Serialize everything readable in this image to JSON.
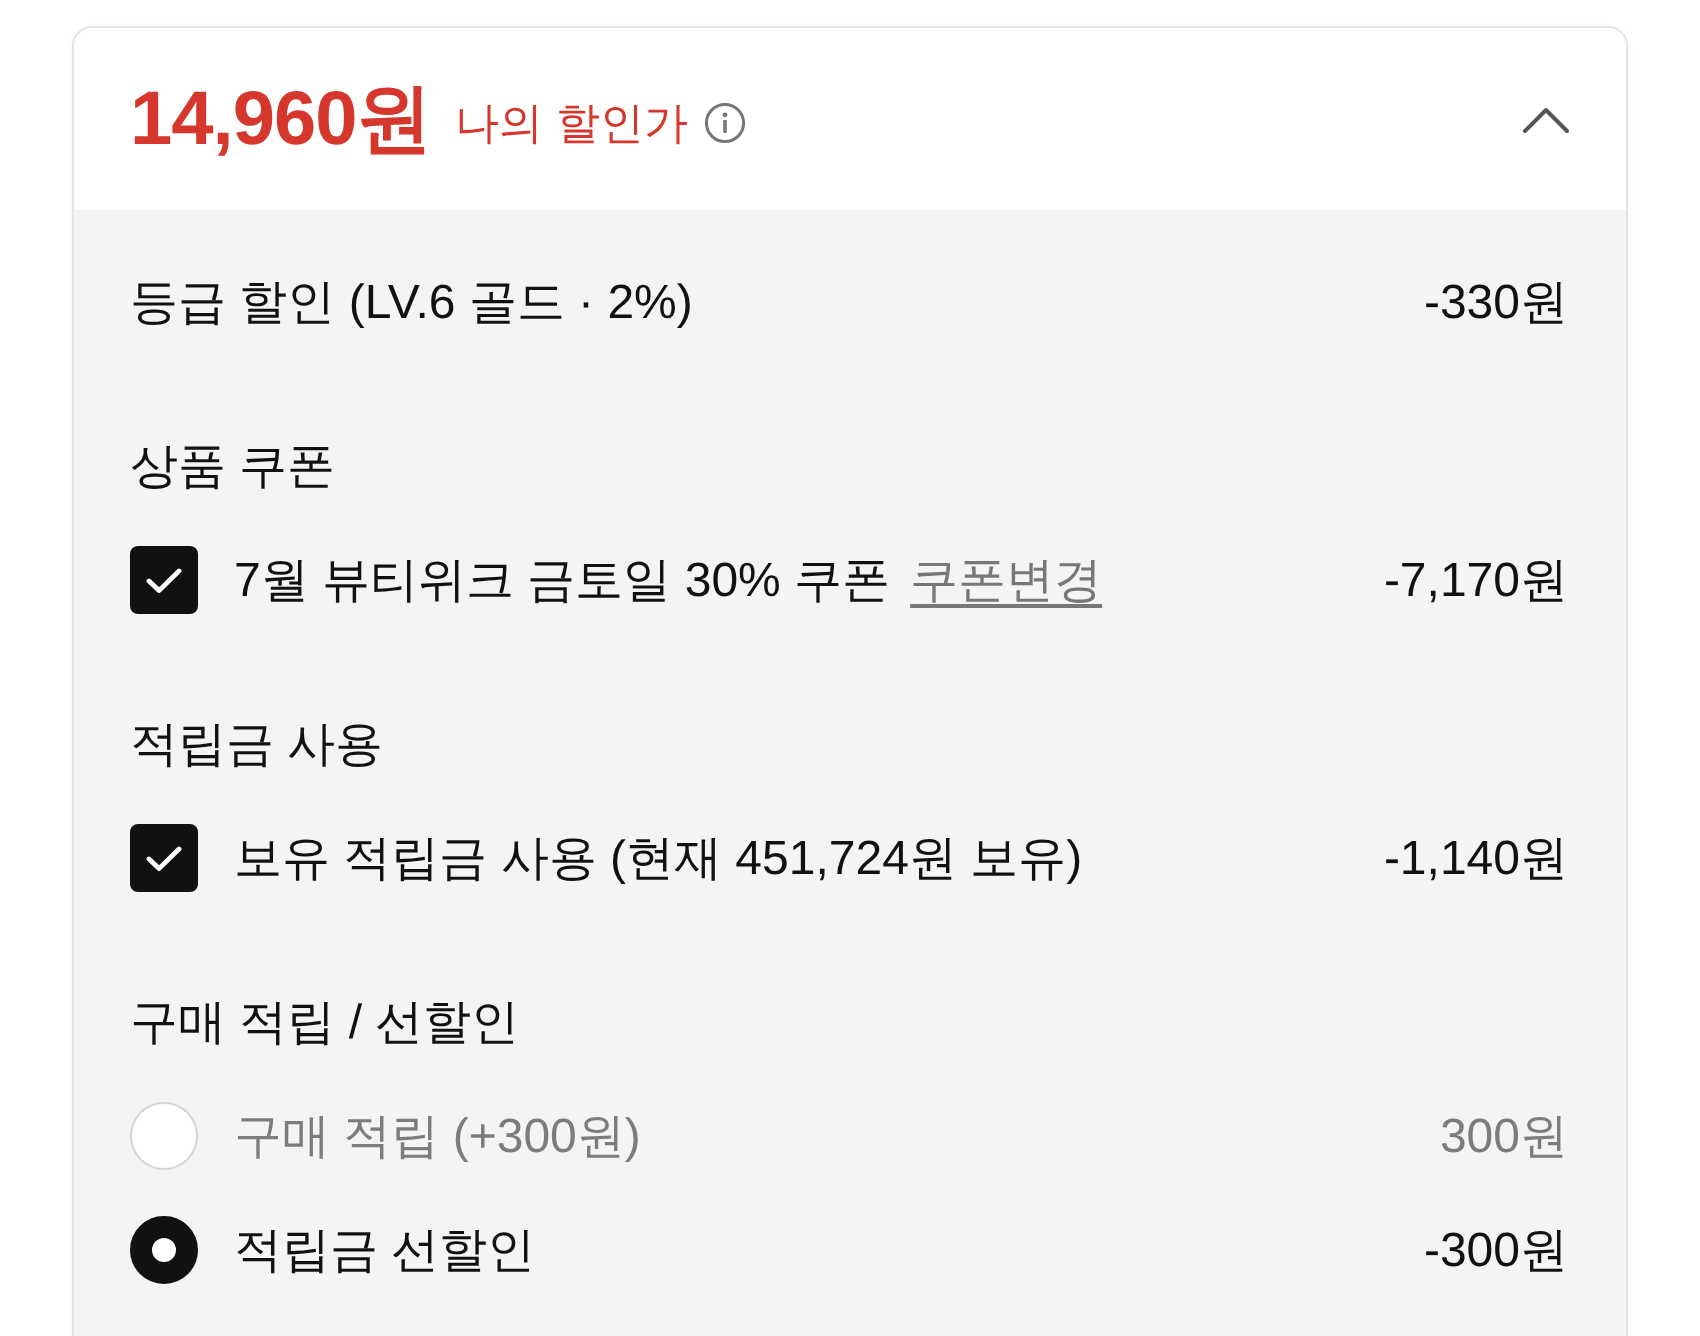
{
  "header": {
    "price": "14,960원",
    "label": "나의 할인가",
    "expanded": true
  },
  "sections": [
    {
      "kind": "row",
      "label": "등급 할인 (LV.6 골드 · 2%)",
      "amount": "-330원"
    },
    {
      "kind": "group",
      "title": "상품 쿠폰",
      "options": [
        {
          "kind": "checkbox",
          "checked": true,
          "label": "7월 뷰티위크 금토일 30% 쿠폰",
          "link": "쿠폰변경",
          "amount": "-7,170원"
        }
      ]
    },
    {
      "kind": "group",
      "title": "적립금 사용",
      "options": [
        {
          "kind": "checkbox",
          "checked": true,
          "label": "보유 적립금 사용 (현재 451,724원 보유)",
          "amount": "-1,140원"
        }
      ]
    },
    {
      "kind": "group",
      "title": "구매 적립 / 선할인",
      "options": [
        {
          "kind": "radio",
          "selected": false,
          "label": "구매 적립 (+300원)",
          "amount": "300원"
        },
        {
          "kind": "radio",
          "selected": true,
          "label": "적립금 선할인",
          "amount": "-300원"
        }
      ]
    }
  ]
}
